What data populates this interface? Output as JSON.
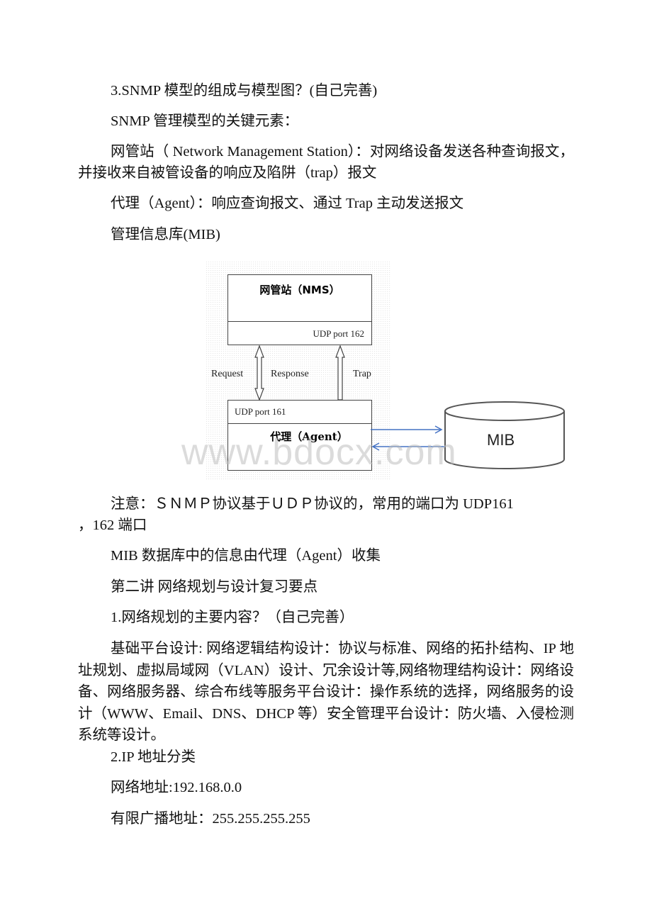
{
  "document": {
    "paragraphs": [
      "3.SNMP 模型的组成与模型图？(自己完善)",
      "SNMP 管理模型的关键元素：",
      "网管站（ Network Management Station）：对网络设备发送各种查询报文，并接收来自被管设备的响应及陷阱（trap）报文",
      "代理（Agent）：响应查询报文、通过 Trap 主动发送报文",
      "管理信息库(MIB)",
      "注意：ＳＮＭＰ协议基于ＵＤＰ协议的，常用的端口为 UDP161，162 端口",
      "MIB 数据库中的信息由代理（Agent）收集",
      "第二讲 网络规划与设计复习要点",
      "1.网络规划的主要内容？（自己完善）",
      "基础平台设计: 网络逻辑结构设计：协议与标准、网络的拓扑结构、IP 地址规划、虚拟局域网（VLAN）设计、冗余设计等,网络物理结构设计：网络设备、网络服务器、综合布线等服务平台设计：操作系统的选择，网络服务的设计（WWW、Email、DNS、DHCP 等）安全管理平台设计：防火墙、入侵检测系统等设计。",
      "2.IP 地址分类",
      "网络地址:192.168.0.0",
      "有限广播地址：255.255.255.255"
    ],
    "note_line1": "注意：ＳＮＭＰ协议基于ＵＤＰ协议的，常用的端口为 UDP161",
    "note_line2": "，162 端口"
  },
  "diagram": {
    "nms": {
      "title": "网管站（NMS）",
      "port": "UDP port 162"
    },
    "agent": {
      "title": "代理（Agent）",
      "port": "UDP port 161"
    },
    "labels": {
      "request": "Request",
      "response": "Response",
      "trap": "Trap"
    },
    "mib": {
      "label": "MIB"
    },
    "colors": {
      "box_border": "#444444",
      "mib_arrow": "#4472c4"
    }
  },
  "watermark": "www.bdocx.com"
}
